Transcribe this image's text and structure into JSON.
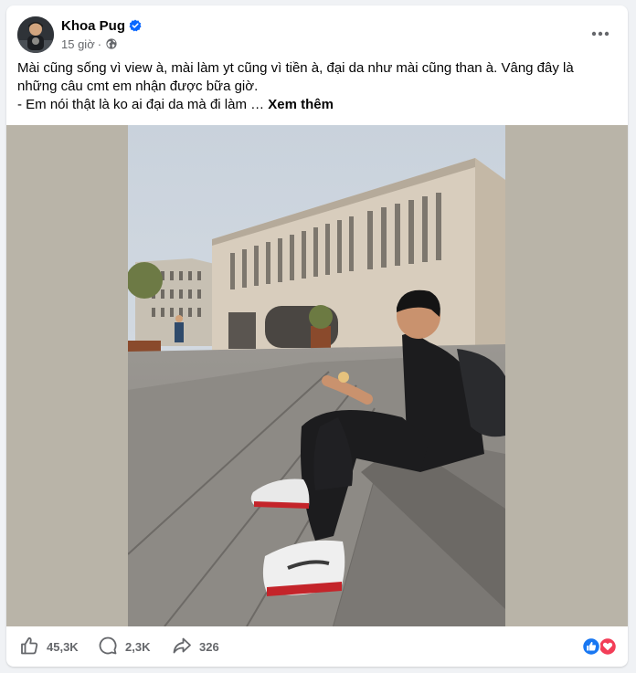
{
  "post": {
    "author": "Khoa Pug",
    "time": "15 giờ",
    "separator": "·",
    "text_line1": "Mài cũng sống vì view à, mài làm yt cũng vì tiền à, đại da như mài cũng than à. Vâng đây là những câu cmt em nhận được bữa giờ.",
    "text_line2": "- Em nói thật là ko ai đại da mà đi làm … ",
    "see_more": "Xem thêm"
  },
  "stats": {
    "likes": "45,3K",
    "comments": "2,3K",
    "shares": "326"
  },
  "colors": {
    "verified_blue": "#0866ff",
    "like_blue": "#1877f2",
    "love_red": "#f33e58",
    "secondary_text": "#65676b"
  },
  "icons": [
    "verified-icon",
    "globe-icon",
    "more-icon",
    "like-icon",
    "comment-icon",
    "share-icon",
    "like-reaction-icon",
    "love-reaction-icon"
  ]
}
